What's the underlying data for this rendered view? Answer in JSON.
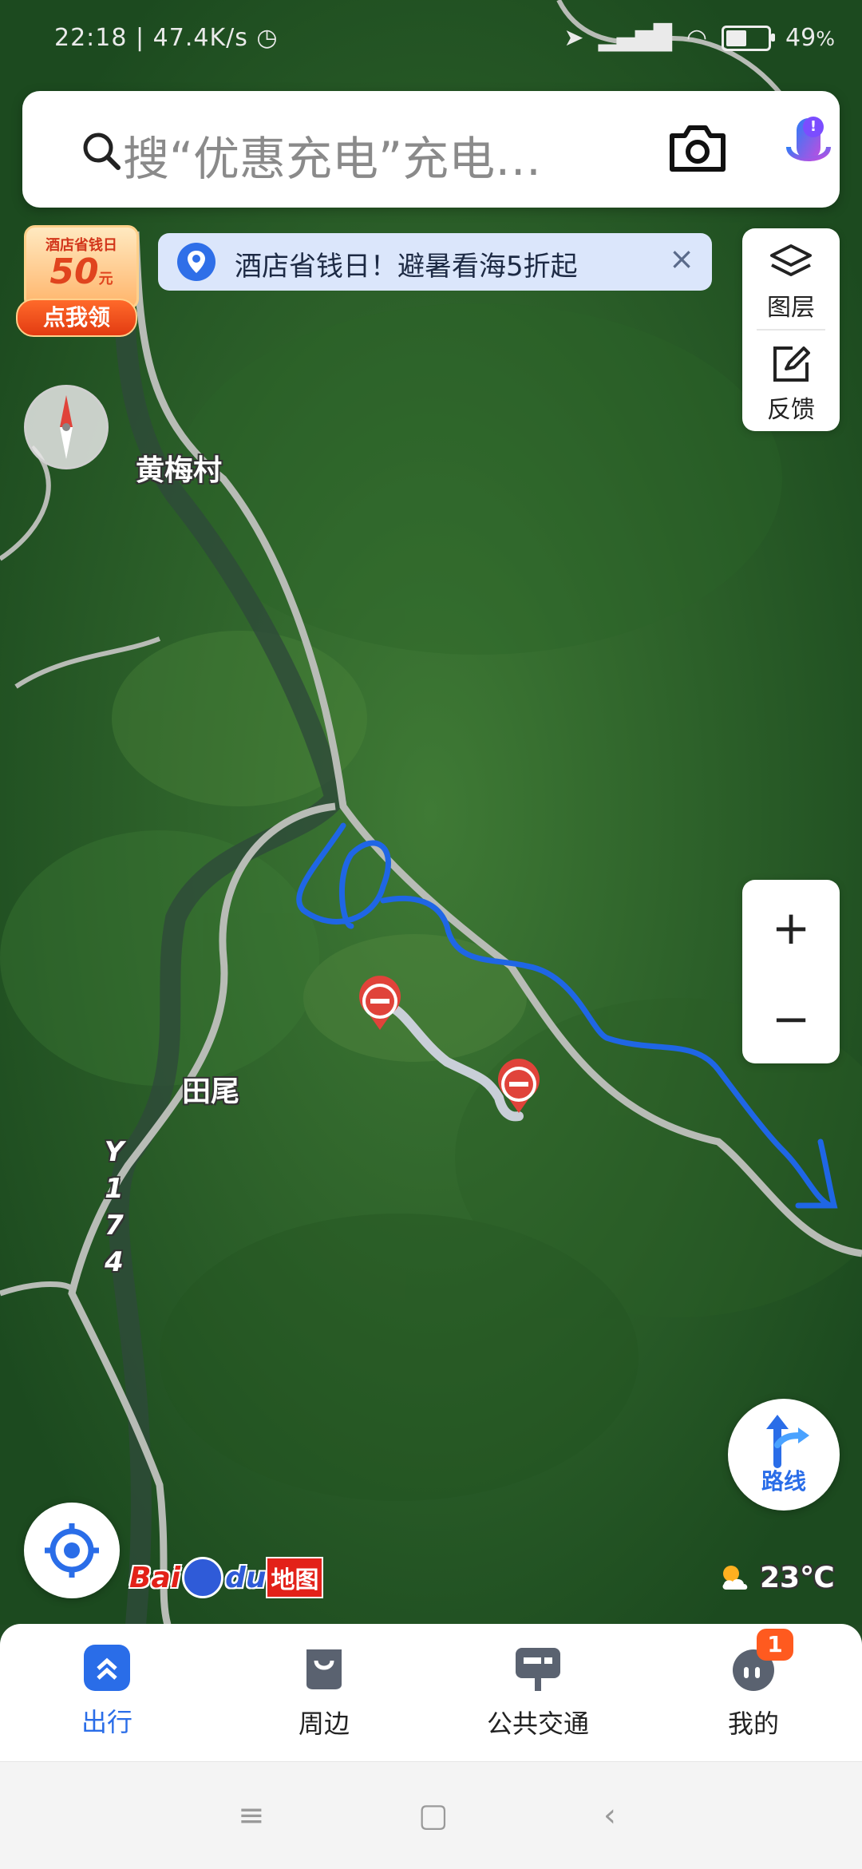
{
  "status_bar": {
    "time": "22:18",
    "speed": "47.4K/s",
    "battery": "49",
    "battery_unit": "%",
    "battery_level": 0.49
  },
  "search": {
    "placeholder": "搜“优惠充电”充电…",
    "icons": [
      "search-icon",
      "camera-icon",
      "microphone-icon"
    ],
    "mic_badge": "!"
  },
  "promo": {
    "top_text": "酒店省钱日",
    "amount": "50",
    "unit": "元",
    "button": "点我领"
  },
  "banner": {
    "text": "酒店省钱日！避暑看海5折起",
    "close": "×"
  },
  "side_tools": {
    "layers_label": "图层",
    "feedback_label": "反馈"
  },
  "map": {
    "places": [
      "黄梅村",
      "田尾"
    ],
    "road": [
      "Y",
      "1",
      "7",
      "4"
    ],
    "closure_markers": 2,
    "annotation_color": "#1f66e5",
    "closed_road_color": "#c9cfd8"
  },
  "zoom": {
    "in": "+",
    "out": "−"
  },
  "route_button": {
    "label": "路线"
  },
  "logo": {
    "bai": "Bai",
    "du": "du",
    "map": "地图"
  },
  "weather": {
    "temp": "23℃",
    "icon": "partly-sunny-icon"
  },
  "tabs": [
    {
      "label": "出行",
      "active": true
    },
    {
      "label": "周边",
      "active": false
    },
    {
      "label": "公共交通",
      "active": false
    },
    {
      "label": "我的",
      "active": false,
      "badge": "1"
    }
  ],
  "colors": {
    "accent": "#2a6de8",
    "badge": "#ff5a1f"
  }
}
